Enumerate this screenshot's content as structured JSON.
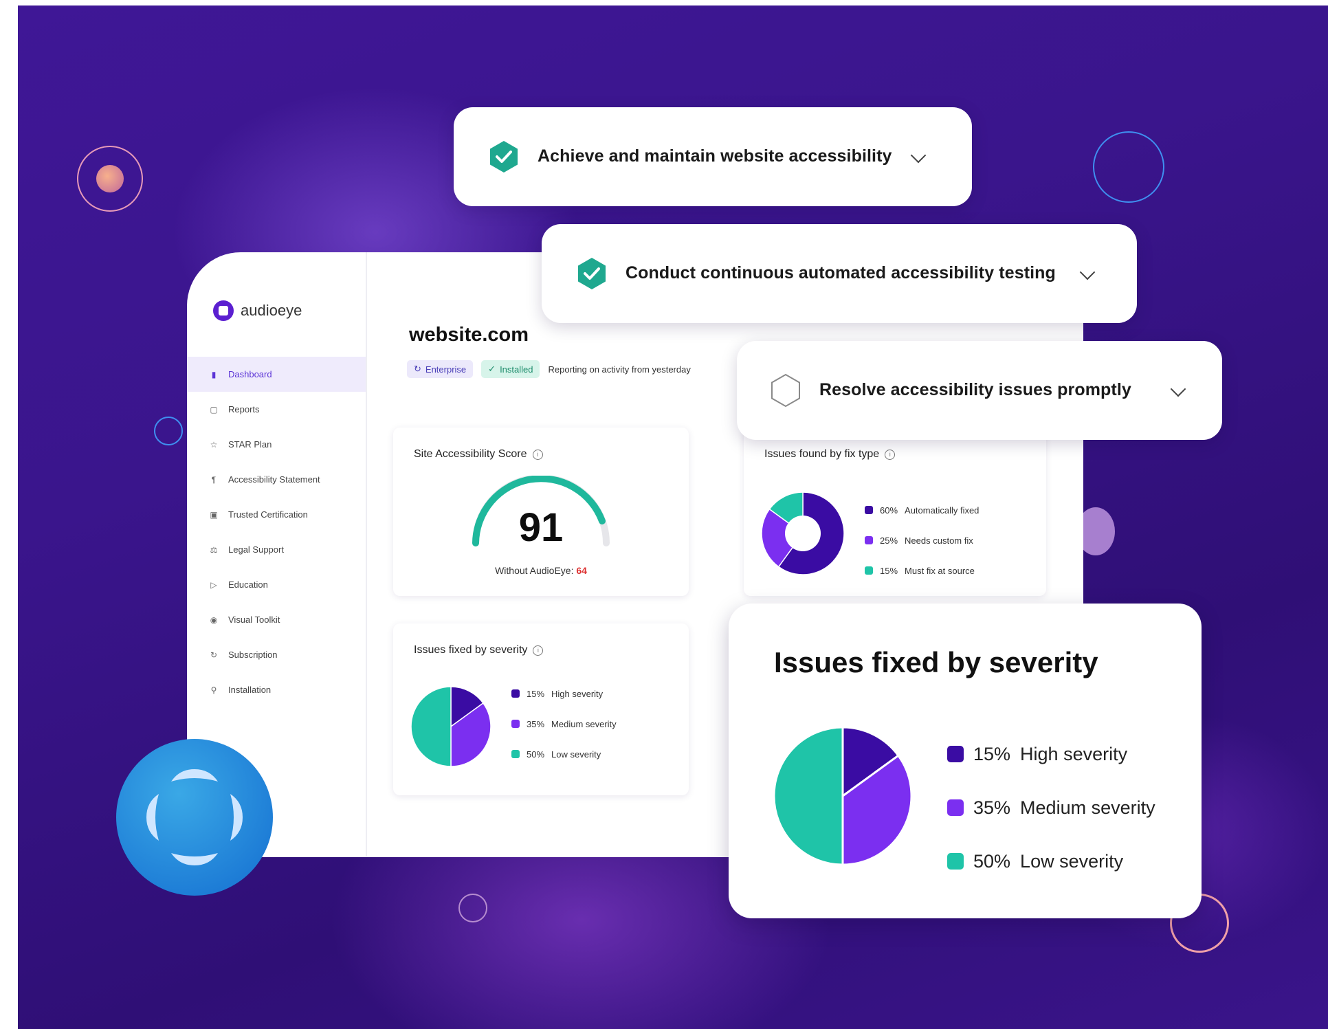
{
  "brand": {
    "name": "audioeye"
  },
  "sidebar": {
    "items": [
      {
        "label": "Dashboard",
        "icon": "bar-chart-icon",
        "active": true
      },
      {
        "label": "Reports",
        "icon": "report-icon",
        "active": false
      },
      {
        "label": "STAR Plan",
        "icon": "star-icon",
        "active": false
      },
      {
        "label": "Accessibility Statement",
        "icon": "statement-icon",
        "active": false
      },
      {
        "label": "Trusted Certification",
        "icon": "certificate-icon",
        "active": false
      },
      {
        "label": "Legal Support",
        "icon": "scales-icon",
        "active": false
      },
      {
        "label": "Education",
        "icon": "play-icon",
        "active": false
      },
      {
        "label": "Visual Toolkit",
        "icon": "accessibility-icon",
        "active": false
      },
      {
        "label": "Subscription",
        "icon": "refresh-icon",
        "active": false
      },
      {
        "label": "Installation",
        "icon": "wrench-icon",
        "active": false
      }
    ]
  },
  "site": {
    "title": "website.com",
    "badge_enterprise": "Enterprise",
    "badge_installed": "Installed",
    "reporting": "Reporting on activity from yesterday"
  },
  "score_card": {
    "title": "Site Accessibility Score",
    "score": "91",
    "without_label": "Without AudioEye:",
    "without_value": "64"
  },
  "fix_type_card": {
    "title": "Issues found by fix type",
    "items": [
      {
        "pct": "60%",
        "label": "Automatically fixed",
        "value": 60,
        "color": "#3a0ca3"
      },
      {
        "pct": "25%",
        "label": "Needs custom fix",
        "value": 25,
        "color": "#7b2ff0"
      },
      {
        "pct": "15%",
        "label": "Must fix at source",
        "value": 15,
        "color": "#1fc4a8"
      }
    ]
  },
  "severity_card": {
    "title": "Issues fixed by severity",
    "items": [
      {
        "pct": "15%",
        "label": "High severity",
        "value": 15,
        "color": "#3a0ca3"
      },
      {
        "pct": "35%",
        "label": "Medium severity",
        "value": 35,
        "color": "#7b2ff0"
      },
      {
        "pct": "50%",
        "label": "Low severity",
        "value": 50,
        "color": "#1fc4a8"
      }
    ]
  },
  "checklist": [
    {
      "label": "Achieve and maintain website accessibility",
      "checked": true
    },
    {
      "label": "Conduct continuous automated accessibility testing",
      "checked": true
    },
    {
      "label": "Resolve accessibility issues promptly",
      "checked": false
    }
  ],
  "big_card": {
    "title": "Issues fixed by severity",
    "items": [
      {
        "pct": "15%",
        "label": "High severity"
      },
      {
        "pct": "35%",
        "label": "Medium severity"
      },
      {
        "pct": "50%",
        "label": "Low severity"
      }
    ]
  },
  "colors": {
    "accent": "#5b33d6",
    "teal": "#1fb89c",
    "dark_purple": "#3a0ca3",
    "purple": "#7b2ff0"
  }
}
